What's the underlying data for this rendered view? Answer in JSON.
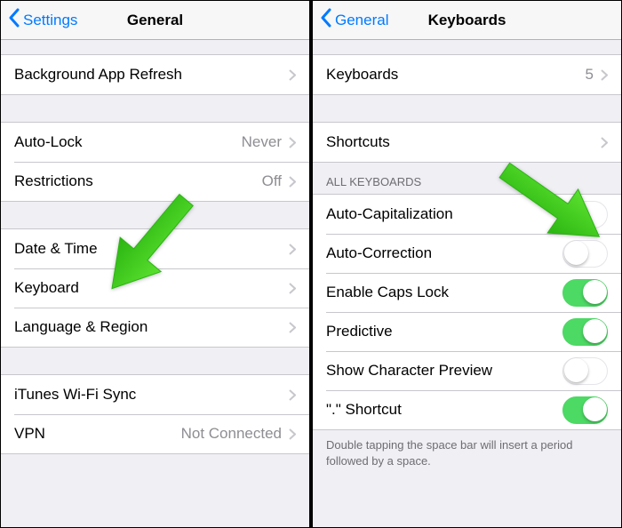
{
  "left": {
    "back_label": "Settings",
    "title": "General",
    "rows": {
      "bg_refresh": "Background App Refresh",
      "auto_lock": "Auto-Lock",
      "auto_lock_value": "Never",
      "restrictions": "Restrictions",
      "restrictions_value": "Off",
      "date_time": "Date & Time",
      "keyboard": "Keyboard",
      "lang_region": "Language & Region",
      "itunes_sync": "iTunes Wi-Fi Sync",
      "vpn": "VPN",
      "vpn_value": "Not Connected"
    }
  },
  "right": {
    "back_label": "General",
    "title": "Keyboards",
    "rows": {
      "keyboards": "Keyboards",
      "keyboards_count": "5",
      "shortcuts": "Shortcuts",
      "section_header": "All Keyboards",
      "auto_cap": "Auto-Capitalization",
      "auto_correct": "Auto-Correction",
      "caps_lock": "Enable Caps Lock",
      "predictive": "Predictive",
      "char_preview": "Show Character Preview",
      "period_shortcut": "\".\" Shortcut",
      "footer": "Double tapping the space bar will insert a period followed by a space."
    },
    "toggles": {
      "auto_cap": false,
      "auto_correct": false,
      "caps_lock": true,
      "predictive": true,
      "char_preview": false,
      "period_shortcut": true
    }
  },
  "annotation": {
    "arrow_color": "#3ecf1f"
  }
}
